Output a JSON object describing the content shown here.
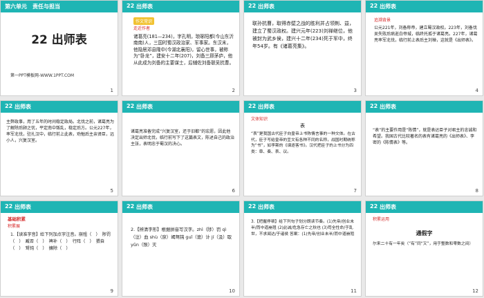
{
  "slides": [
    {
      "num": "1",
      "bar_num": "",
      "bar_title": "第六单元　责任与担当",
      "title": "22 出师表",
      "note": "第一PPT模板网-WWW.1PPT.COM"
    },
    {
      "num": "2",
      "bar_num": "22",
      "bar_title": "出师表",
      "tag1": "作文常识",
      "tag2": "走近作者",
      "body": "诸葛亮(181—234)，字孔明，琅琊阳都(今山东沂南南)人，三国时蜀汉政治家、军事家。东汉末，他隐居邓县隆中(今湖北襄阳)，留心世事，被称为“卧龙”，建安十二年(207)，刘备三顾茅庐，他从此成为刘备的主要谋士，后辅佐刘备联吴抗曹。"
    },
    {
      "num": "3",
      "bar_num": "22",
      "bar_title": "出师表",
      "body": "联孙抗曹，取得赤壁之战的胜利并占领荆、益，建立了蜀汉政权。建兴元年(223)刘禅继位，他被封为武乡侯，建兴十二年(234)死于军中，终年54岁。有《诸葛亮集》。"
    },
    {
      "num": "4",
      "bar_num": "22",
      "bar_title": "出师表",
      "tag1": "追溯背景",
      "body": "公元221年，刘备称帝，建立蜀汉政权。223年，刘备伐吴失败后病逝白帝城，临终托孤于诸葛亮。227年，诸葛亮率军北伐，临行前上表后主刘禅，这就是《出师表》。"
    },
    {
      "num": "5",
      "bar_num": "22",
      "bar_title": "出师表",
      "body": "主弊政事，用了五年的时间稳定政局。北伐之前，诸葛亮为了解除后顾之忧，平定南中叛乱，稳定后方。公元227年，率军北伐，驻扎汉中，临行前上此表，劝勉后主亲贤臣，远小人，兴复汉室。"
    },
    {
      "num": "6",
      "bar_num": "22",
      "bar_title": "出师表",
      "body": "诸葛亮准备完成“兴复汉室，还于旧都”的宏愿，因此他决定出师北伐，临行前写下了这篇表文，陈述自己的政治主张，表明忠于蜀汉的决心。"
    },
    {
      "num": "7",
      "bar_num": "22",
      "bar_title": "出师表",
      "tag1": "文体知识",
      "center": "表",
      "body": "“表”是我国古代臣子向皇帝上书陈情言事的一种文体。在古代，臣子写给皇帝的呈文有各种不同的名称，战国时期统称为“书”，如李斯的《谏逐客书》。汉代把臣子的上书分为四类：章、奏、表、议。"
    },
    {
      "num": "8",
      "bar_num": "22",
      "bar_title": "出师表",
      "body": "“表”的主要作用是“陈情”，就是表达臣子对君主的忠诚和希望。我国古代比较著名的表有诸葛亮的《出师表》、李密的《陈情表》等。"
    },
    {
      "num": "9",
      "bar_num": "22",
      "bar_title": "出师表",
      "tag1": "基础积累",
      "tag2": "积累展",
      "body": "1.【读准字音】给下列加点字注音。崩殂（　）　陟罚（　）　臧否（　）　裨补（　）　行阵（　）　猥自（　）　驽钝（　）　攘除（　）"
    },
    {
      "num": "10",
      "bar_num": "22",
      "bar_title": "出师表",
      "body": "2.【辨清字形】根据拼音写汉字。zhì（陟）罚 qì（泣）血 shù（庶）竭驽钝 guǐ（诡）计 jí（汲）取 yǔn（殒）灭"
    },
    {
      "num": "11",
      "bar_num": "22",
      "bar_title": "出师表",
      "body": "3.【把握停顿】给下列句子划分朗读节奏。(1)先帝/创业未半/而中道崩殂 (2)此诚/危急存亡之秋也 (3)苟全性命/于乱世，不求闻达/于诸侯 答案：(1)先帝/创业未半/而中道崩殂"
    },
    {
      "num": "12",
      "bar_num": "22",
      "bar_title": "出师表",
      "tag1": "积累运用",
      "sub_title": "通假字",
      "body": "尔来二十有一年矣（“有”同“又”，用于整数和零数之间）"
    }
  ]
}
